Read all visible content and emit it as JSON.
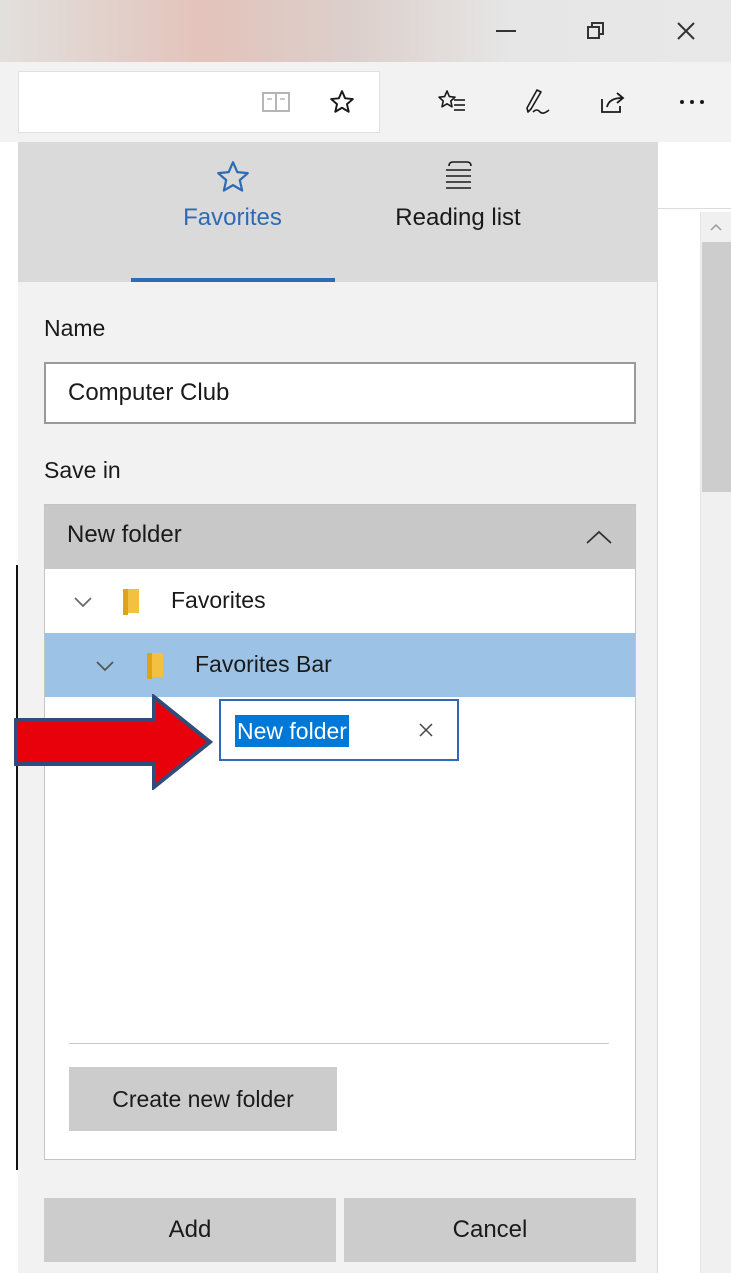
{
  "hub": {
    "tabs": [
      {
        "label": "Favorites",
        "icon": "star-outline-icon",
        "active": true
      },
      {
        "label": "Reading list",
        "icon": "reading-list-icon",
        "active": false
      }
    ],
    "name_label": "Name",
    "name_value": "Computer Club",
    "save_in_label": "Save in",
    "save_in": {
      "selected_folder": "New folder",
      "tree": [
        {
          "label": "Favorites",
          "level": 0,
          "expanded": true
        },
        {
          "label": "Favorites Bar",
          "level": 1,
          "expanded": true,
          "selected": true
        }
      ],
      "new_folder_value": "New folder",
      "create_new_folder_label": "Create new folder"
    },
    "add_label": "Add",
    "cancel_label": "Cancel"
  },
  "colors": {
    "accent": "#2d6bb5",
    "selected_row": "#9cc3e6",
    "text_selection": "#0078d7",
    "annotation_arrow": "#e8000b"
  }
}
